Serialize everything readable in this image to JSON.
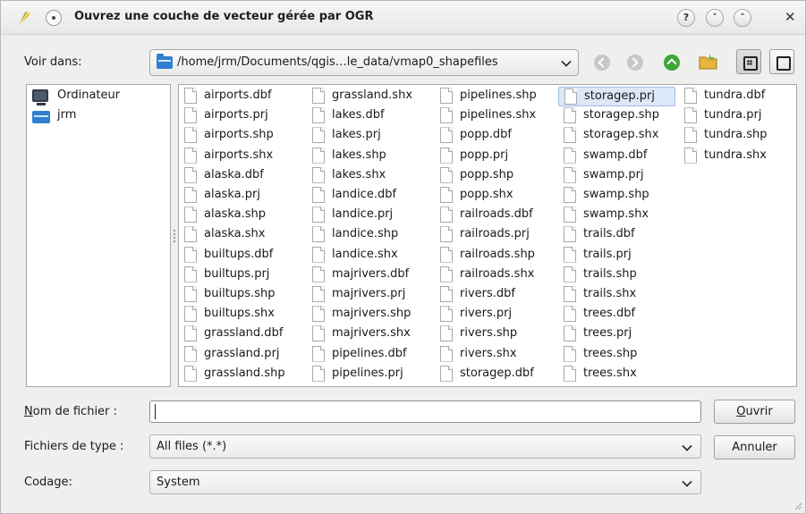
{
  "window": {
    "title": "Ouvrez une couche de vecteur gérée par OGR",
    "help_label": "?",
    "minimize_label": "˅",
    "maximize_label": "˄",
    "close_label": "✕"
  },
  "lookin": {
    "label": "Voir dans:",
    "path": "/home/jrm/Documents/qgis…le_data/vmap0_shapefiles"
  },
  "sidebar": {
    "items": [
      {
        "label": "Ordinateur",
        "icon": "computer-icon"
      },
      {
        "label": "jrm",
        "icon": "home-folder-icon"
      }
    ]
  },
  "files": {
    "columns": [
      [
        "airports.dbf",
        "airports.prj",
        "airports.shp",
        "airports.shx",
        "alaska.dbf",
        "alaska.prj",
        "alaska.shp",
        "alaska.shx",
        "builtups.dbf",
        "builtups.prj",
        "builtups.shp",
        "builtups.shx",
        "grassland.dbf",
        "grassland.prj",
        "grassland.shp"
      ],
      [
        "grassland.shx",
        "lakes.dbf",
        "lakes.prj",
        "lakes.shp",
        "lakes.shx",
        "landice.dbf",
        "landice.prj",
        "landice.shp",
        "landice.shx",
        "majrivers.dbf",
        "majrivers.prj",
        "majrivers.shp",
        "majrivers.shx",
        "pipelines.dbf",
        "pipelines.prj"
      ],
      [
        "pipelines.shp",
        "pipelines.shx",
        "popp.dbf",
        "popp.prj",
        "popp.shp",
        "popp.shx",
        "railroads.dbf",
        "railroads.prj",
        "railroads.shp",
        "railroads.shx",
        "rivers.dbf",
        "rivers.prj",
        "rivers.shp",
        "rivers.shx",
        "storagep.dbf"
      ],
      [
        "storagep.prj",
        "storagep.shp",
        "storagep.shx",
        "swamp.dbf",
        "swamp.prj",
        "swamp.shp",
        "swamp.shx",
        "trails.dbf",
        "trails.prj",
        "trails.shp",
        "trails.shx",
        "trees.dbf",
        "trees.prj",
        "trees.shp",
        "trees.shx"
      ],
      [
        "tundra.dbf",
        "tundra.prj",
        "tundra.shp",
        "tundra.shx"
      ]
    ],
    "selected": "storagep.prj"
  },
  "form": {
    "filename_label_first": "N",
    "filename_label_rest": "om de fichier :",
    "filename_value": "",
    "filetype_label": "Fichiers de type :",
    "filetype_value": "All files (*.*)",
    "encoding_label": "Codage:",
    "encoding_value": "System",
    "open_first": "O",
    "open_rest": "uvrir",
    "cancel_label": "Annuler"
  },
  "colors": {
    "selection": "#dce7f8",
    "folder_blue": "#2f7fd0",
    "up_green": "#3fa538"
  }
}
